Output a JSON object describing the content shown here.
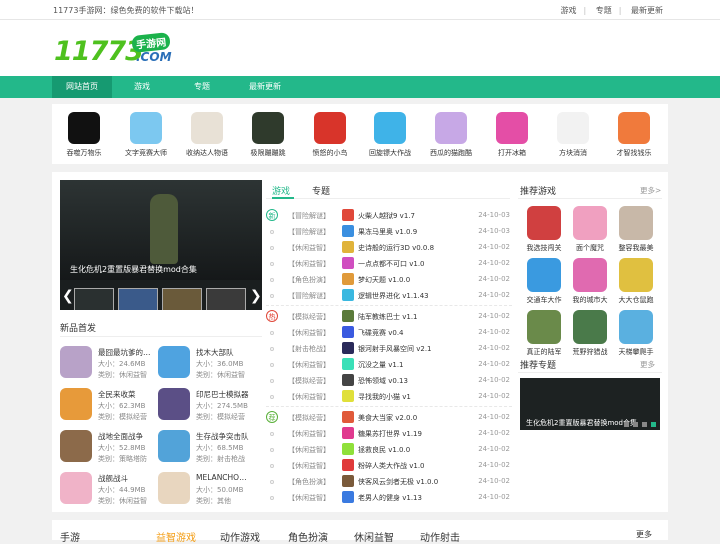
{
  "topbar": {
    "slogan": "11773手游网：绿色免费的软件下载站！",
    "links": [
      "游戏",
      "专题",
      "最新更新"
    ]
  },
  "logo": {
    "num": "11773",
    "tag": "手游网",
    "com": ".COM"
  },
  "nav": [
    "网站首页",
    "游戏",
    "专题",
    "最新更新"
  ],
  "hot_games": [
    {
      "name": "吞噬万物乐",
      "color": "#111"
    },
    {
      "name": "文字竞赛大师",
      "color": "#7cc8f0"
    },
    {
      "name": "收纳达人物语",
      "color": "#e8e1d6"
    },
    {
      "name": "极限蹦蹦跳",
      "color": "#2f3a2c"
    },
    {
      "name": "愤怒的小鸟",
      "color": "#d8342a"
    },
    {
      "name": "回旋镖大作战",
      "color": "#3fb3e8"
    },
    {
      "name": "西瓜的猫跑酷",
      "color": "#c7a8e6"
    },
    {
      "name": "打开冰箱",
      "color": "#e44ea6"
    },
    {
      "name": "方块消消",
      "color": "#f2f2f2"
    },
    {
      "name": "才智找钱乐",
      "color": "#f07a3c"
    }
  ],
  "slider": {
    "caption": "生化危机2重置版暴君替换mod合集",
    "arrow_left": "❮",
    "arrow_right": "❯"
  },
  "new_title": "新品首发",
  "new_games": [
    {
      "title": "最囧最坑爹的…",
      "size": "大小：24.6MB",
      "cat": "类别：休闲益智",
      "color": "#b8a2c8"
    },
    {
      "title": "找木大部队",
      "size": "大小：36.0MB",
      "cat": "类别：休闲益智",
      "color": "#4fa3e0"
    },
    {
      "title": "全民来收菜",
      "size": "大小：62.3MB",
      "cat": "类别：模拟经营",
      "color": "#e79a3a"
    },
    {
      "title": "印尼巴士模拟器",
      "size": "大小：274.5MB",
      "cat": "类别：模拟经营",
      "color": "#5b4f86"
    },
    {
      "title": "战地全面战争",
      "size": "大小：52.8MB",
      "cat": "类别：策略塔防",
      "color": "#8c6a4a"
    },
    {
      "title": "生存战争突击队",
      "size": "大小：68.5MB",
      "cat": "类别：射击枪战",
      "color": "#52a3d9"
    },
    {
      "title": "战舰战斗",
      "size": "大小：44.9MB",
      "cat": "类别：休闲益智",
      "color": "#f0b3c8"
    },
    {
      "title": "MELANCHO…",
      "size": "大小：50.0MB",
      "cat": "类别：其他",
      "color": "#e8d6bf"
    }
  ],
  "tabs": [
    "游戏",
    "专题"
  ],
  "badges": [
    "新",
    "热",
    "荐"
  ],
  "list": [
    {
      "cat": "【冒险解谜】",
      "name": "火柴人越狱9 v1.7",
      "date": "24-10-03",
      "color": "#e0483a"
    },
    {
      "cat": "【冒险解谜】",
      "name": "果冻马里奥 v1.0.9",
      "date": "24-10-03",
      "color": "#3a8fe0"
    },
    {
      "cat": "【休闲益智】",
      "name": "史诗般的运行3D v0.0.8",
      "date": "24-10-02",
      "color": "#e0b33a"
    },
    {
      "cat": "【休闲益智】",
      "name": "一点点都不可口 v1.0",
      "date": "24-10-02",
      "color": "#d04ec0"
    },
    {
      "cat": "【角色扮演】",
      "name": "梦幻天题 v1.0.0",
      "date": "24-10-02",
      "color": "#e09a3a"
    },
    {
      "cat": "【冒险解谜】",
      "name": "逻辑世界进化 v1.1.43",
      "date": "24-10-02",
      "color": "#3ab8e0"
    },
    {
      "cat": "【模拟经营】",
      "name": "陆军教练巴士 v1.1",
      "date": "24-10-02",
      "color": "#5a7a3a"
    },
    {
      "cat": "【休闲益智】",
      "name": "飞碟竞赛 v0.4",
      "date": "24-10-02",
      "color": "#3a5ae0"
    },
    {
      "cat": "【射击枪战】",
      "name": "银河射手风暴空间 v2.1",
      "date": "24-10-02",
      "color": "#2a2a5a"
    },
    {
      "cat": "【休闲益智】",
      "name": "沉没之量 v1.1",
      "date": "24-10-02",
      "color": "#3ae0b8"
    },
    {
      "cat": "【模拟经营】",
      "name": "恐怖领域 v0.13",
      "date": "24-10-02",
      "color": "#444"
    },
    {
      "cat": "【休闲益智】",
      "name": "寻找我的小猫 v1",
      "date": "24-10-02",
      "color": "#e0e03a"
    },
    {
      "cat": "【模拟经营】",
      "name": "美食大当家 v2.0.0",
      "date": "24-10-02",
      "color": "#e05a3a"
    },
    {
      "cat": "【休闲益智】",
      "name": "糖果苏打世界 v1.19",
      "date": "24-10-02",
      "color": "#e03a8f"
    },
    {
      "cat": "【休闲益智】",
      "name": "拯救良民 v1.0.0",
      "date": "24-10-02",
      "color": "#8fe03a"
    },
    {
      "cat": "【休闲益智】",
      "name": "粉碎人类大作战 v1.0",
      "date": "24-10-02",
      "color": "#e03a3a"
    },
    {
      "cat": "【角色扮演】",
      "name": "侠客风云剑者无极 v1.0.0",
      "date": "24-10-02",
      "color": "#7a5a3a"
    },
    {
      "cat": "【休闲益智】",
      "name": "老男人的健身 v1.13",
      "date": "24-10-02",
      "color": "#3a7ae0"
    }
  ],
  "recommend": {
    "title": "推荐游戏",
    "more": "更多>",
    "games": [
      {
        "name": "我选技闯关",
        "color": "#d04040"
      },
      {
        "name": "面个魔咒",
        "color": "#f0a0c0"
      },
      {
        "name": "整容我最美",
        "color": "#c8b8a8"
      },
      {
        "name": "交通车大作",
        "color": "#3a9ae0"
      },
      {
        "name": "我的城市大",
        "color": "#e06ab0"
      },
      {
        "name": "大大仓鼠跑",
        "color": "#e0c040"
      },
      {
        "name": "真正的陆军",
        "color": "#6a8a4a"
      },
      {
        "name": "荒野狩猎战",
        "color": "#4a7a4a"
      },
      {
        "name": "天梯攀爬手",
        "color": "#5ab0e0"
      }
    ]
  },
  "topic": {
    "title": "推荐专题",
    "more": "更多",
    "caption": "生化危机2重置版暴君替换mod合集"
  },
  "bottom_heads": [
    "手游",
    "益智游戏",
    "动作游戏",
    "角色扮演",
    "休闲益智",
    "动作射击",
    "更多"
  ]
}
